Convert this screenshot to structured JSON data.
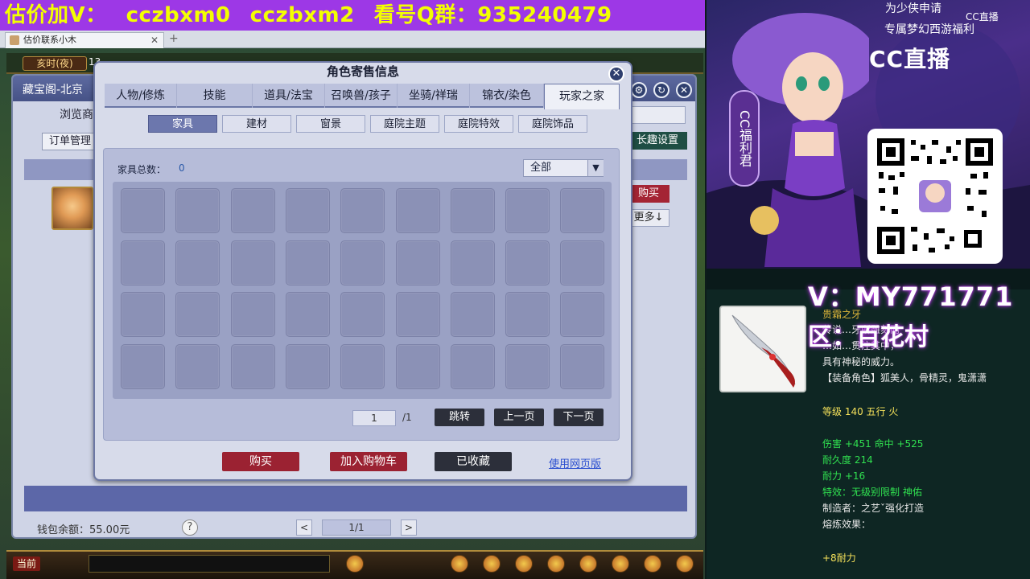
{
  "banner": {
    "p1": "估价加V：",
    "p2": "cczbxm0",
    "p3": "cczbxm2",
    "p4": "看号Q群：935240479"
  },
  "browser": {
    "tab_title": "估价联系小木",
    "close": "✕",
    "add": "+"
  },
  "game": {
    "time": "亥时(夜)",
    "time_num": "13",
    "window_title": "藏宝阁-北京",
    "browse": "浏览商",
    "order_tab": "订单管理",
    "buy_right": "购买",
    "more": "更多↓",
    "setting": "长趣设置",
    "wallet": "钱包余额：55.00元",
    "help": "?",
    "pager_prev": "<",
    "pager_value": "1/1",
    "pager_next": ">",
    "hud_label": "当前"
  },
  "modal": {
    "title": "角色寄售信息",
    "close": "✕",
    "tabs": [
      "人物/修炼",
      "技能",
      "道具/法宝",
      "召唤兽/孩子",
      "坐骑/祥瑞",
      "锦衣/染色",
      "玩家之家"
    ],
    "active_tab": 6,
    "subtabs": [
      "家具",
      "建材",
      "窗景",
      "庭院主题",
      "庭院特效",
      "庭院饰品"
    ],
    "active_subtab": 0,
    "furniture_label": "家具总数：",
    "furniture_count": "0",
    "filter_value": "全部",
    "filter_arrow": "▼",
    "grid_rows": 4,
    "grid_cols": 9,
    "page_input": "1",
    "page_total": "/1",
    "jump": "跳转",
    "prev_page": "上一页",
    "next_page": "下一页",
    "buy": "购买",
    "add_cart": "加入购物车",
    "favorited": "已收藏",
    "web_link": "使用网页版"
  },
  "promo": {
    "line1": "为少侠申请",
    "line2": "专属梦幻西游福利",
    "cc_small": "CC直播",
    "cc_big": "CC直播",
    "fuli": "CC福利君"
  },
  "overlay": {
    "vname": "V：MY771771",
    "area": "区：百花村"
  },
  "item": {
    "name": "贵霜之牙",
    "desc": [
      "传说…牙所雕刻而",
      "…如…贯注其中，",
      "具有神秘的威力。",
      "【装备角色】狐美人，骨精灵，鬼潇潇"
    ],
    "level": "等级 140  五行 火",
    "attack": "伤害 +451  命中 +525",
    "durability": "耐久度 214",
    "endurance": "耐力 +16",
    "effect": "特效：无级别限制 神佑",
    "maker": "制造者：之艺ˇ强化打造",
    "refine": "熔炼效果：",
    "refine_val": "+8耐力"
  },
  "colors": {
    "banner_bg": "#9d38e6",
    "banner_text": "#f3ff00",
    "buy_red": "#9b2232",
    "dark_btn": "#2c2f3a",
    "active_subtab": "#6c77ad"
  }
}
